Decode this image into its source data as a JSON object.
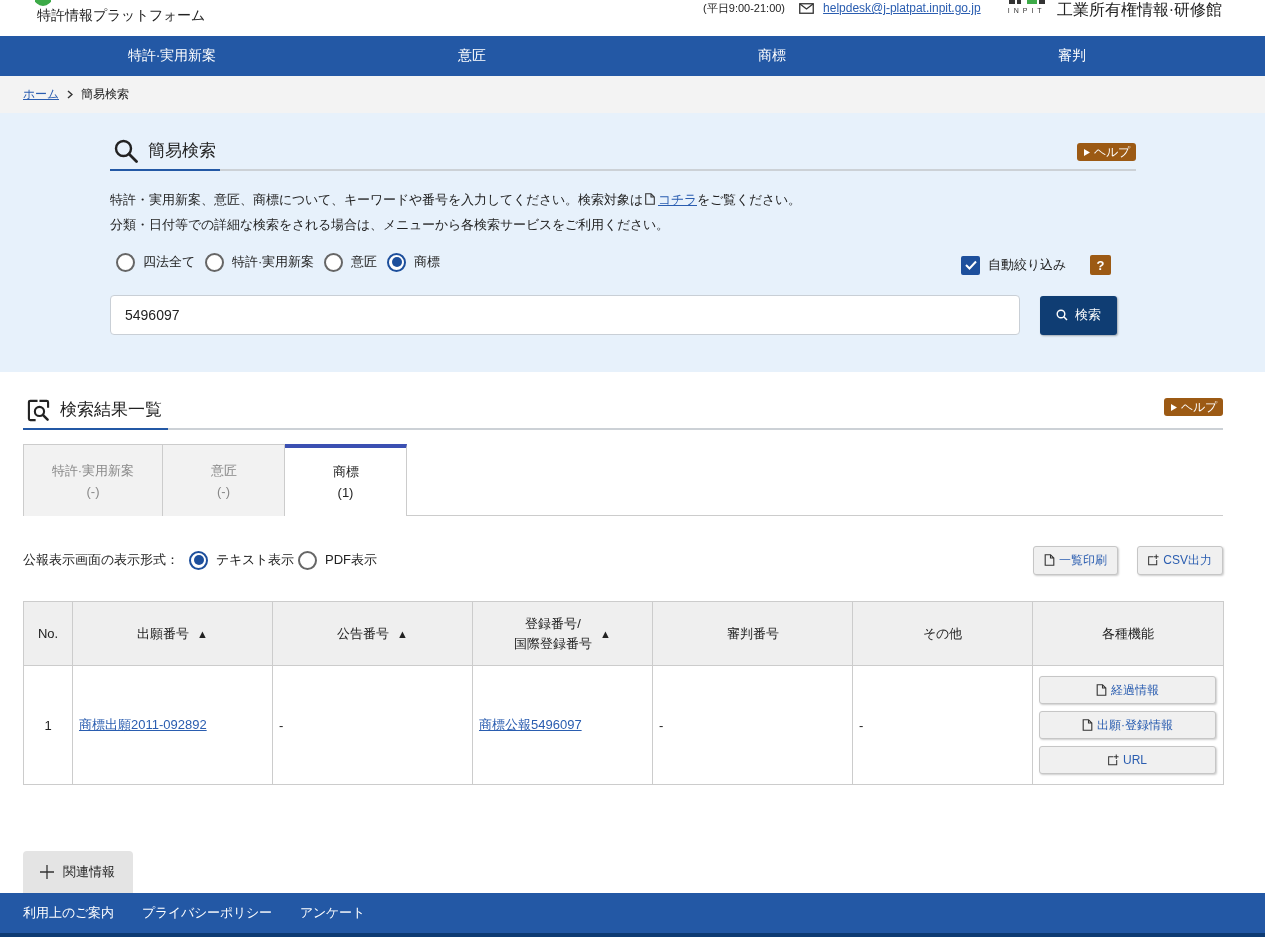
{
  "header": {
    "logo_text": "特許情報プラットフォーム",
    "hours": "(平日9:00-21:00)",
    "email": "helpdesk@j-platpat.inpit.go.jp",
    "org_mark": "INPIT",
    "org_name": "工業所有権情報·研修館"
  },
  "nav": [
    {
      "label": "特許·実用新案"
    },
    {
      "label": "意匠"
    },
    {
      "label": "商標"
    },
    {
      "label": "審判"
    }
  ],
  "breadcrumb": [
    {
      "label": "ホーム",
      "kind": "link"
    },
    {
      "label": "簡易検索",
      "kind": "current"
    }
  ],
  "search": {
    "title": "簡易検索",
    "help": "ヘルプ",
    "description": [
      {
        "before": "特許・実用新案、意匠、商標について、キーワードや番号を入力してください。検索対象は",
        "link": "コチラ",
        "after": "をご覧ください。"
      },
      {
        "before": "分類・日付等での詳細な検索をされる場合は、メニューから各検索サービスをご利用ください。"
      }
    ],
    "targets": [
      {
        "label": "四法全て",
        "selected": false
      },
      {
        "label": "特許·実用新案",
        "selected": false
      },
      {
        "label": "意匠",
        "selected": false
      },
      {
        "label": "商標",
        "selected": true
      }
    ],
    "auto_filter": {
      "label": "自動絞り込み",
      "checked": true
    },
    "hint": "?",
    "query": {
      "value": "5496097"
    },
    "button": "検索"
  },
  "results": {
    "title": "検索結果一覧",
    "help": "ヘルプ",
    "tabs": [
      {
        "label": "特許·実用新案",
        "count": "(-)",
        "selected": false
      },
      {
        "label": "意匠",
        "count": "(-)",
        "selected": false
      },
      {
        "label": "商標",
        "count": "(1)",
        "selected": true
      }
    ],
    "display_format": {
      "label": "公報表示画面の表示形式：",
      "options": [
        {
          "label": "テキスト表示",
          "selected": true
        },
        {
          "label": "PDF表示",
          "selected": false
        }
      ]
    },
    "actions": [
      {
        "label": "一覧印刷",
        "kind": "sheet"
      },
      {
        "label": "CSV出力",
        "kind": "export"
      }
    ],
    "table": {
      "columns": [
        {
          "lines": [
            "No."
          ]
        },
        {
          "lines": [
            "出願番号"
          ],
          "sort_mark": "▲"
        },
        {
          "lines": [
            "公告番号"
          ],
          "sort_mark": "▲"
        },
        {
          "lines": [
            "登録番号/",
            "国際登録番号"
          ],
          "sort_mark": "▲"
        },
        {
          "lines": [
            "審判番号"
          ]
        },
        {
          "lines": [
            "その他"
          ]
        },
        {
          "lines": [
            "各種機能"
          ]
        }
      ],
      "rows": [
        {
          "cells": [
            {
              "text": "1",
              "kind": "number"
            },
            {
              "text": "商標出願2011-092892",
              "kind": "link"
            },
            {
              "text": "-",
              "kind": "plain"
            },
            {
              "text": "商標公報5496097",
              "kind": "link"
            },
            {
              "text": "-",
              "kind": "plain"
            },
            {
              "text": "-",
              "kind": "plain"
            }
          ],
          "functions": [
            {
              "label": "経過情報",
              "kind": "sheet"
            },
            {
              "label": "出願·登録情報",
              "kind": "sheet"
            },
            {
              "label": "URL",
              "kind": "export"
            }
          ]
        }
      ]
    }
  },
  "related": {
    "label": "関連情報"
  },
  "footer": [
    {
      "label": "利用上のご案内"
    },
    {
      "label": "プライバシーポリシー"
    },
    {
      "label": "アンケート"
    }
  ]
}
